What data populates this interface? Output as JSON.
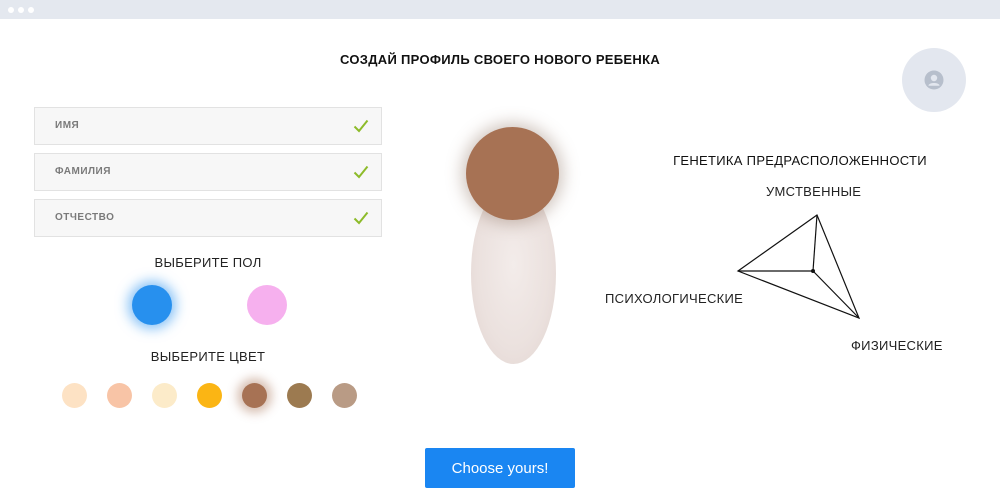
{
  "page": {
    "title": "СОЗДАЙ ПРОФИЛЬ СВОЕГО НОВОГО РЕБЕНКА",
    "avatar_icon": "user-icon"
  },
  "form": {
    "fields": [
      {
        "label": "ИМЯ",
        "status_icon": "check-icon",
        "status_color": "#8dbb2a"
      },
      {
        "label": "ФАМИЛИЯ",
        "status_icon": "check-icon",
        "status_color": "#8dbb2a"
      },
      {
        "label": "ОТЧЕСТВО",
        "status_icon": "check-icon",
        "status_color": "#8dbb2a"
      }
    ]
  },
  "gender": {
    "label": "ВЫБЕРИТЕ ПОЛ",
    "options": [
      {
        "name": "male",
        "color": "#2790ee",
        "selected": true
      },
      {
        "name": "female",
        "color": "#f6b0ee",
        "selected": false
      }
    ]
  },
  "color": {
    "label": "ВЫБЕРИТЕ ЦВЕТ",
    "swatches": [
      {
        "color": "#fde2c4",
        "selected": false
      },
      {
        "color": "#f8c4a6",
        "selected": false
      },
      {
        "color": "#fcebc9",
        "selected": false
      },
      {
        "color": "#fbb514",
        "selected": false
      },
      {
        "color": "#a77254",
        "selected": true
      },
      {
        "color": "#9c7a50",
        "selected": false
      },
      {
        "color": "#b99b85",
        "selected": false
      }
    ]
  },
  "preview": {
    "head_color": "#a77254"
  },
  "genetics": {
    "title": "ГЕНЕТИКА ПРЕДРАСПОЛОЖЕННОСТИ",
    "axes": {
      "top": "УМСТВЕННЫЕ",
      "left": "ПСИХОЛОГИЧЕСКИЕ",
      "bottom_right": "ФИЗИЧЕСКИЕ"
    }
  },
  "cta": {
    "label": "Choose yours!"
  },
  "colors": {
    "accent": "#1a86f2",
    "check": "#8dbb2a"
  }
}
